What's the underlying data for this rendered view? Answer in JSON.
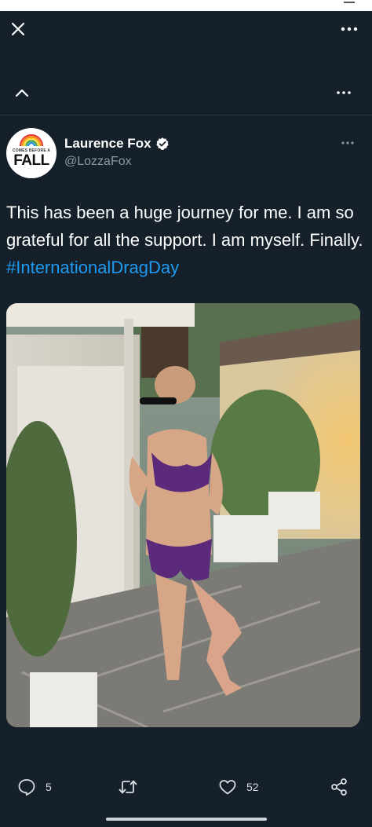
{
  "colors": {
    "background": "#15202b",
    "link": "#1d9bf0",
    "secondary_text": "#8b98a5",
    "verified": "#ffffff"
  },
  "icons": {
    "close": "close-icon",
    "more": "more-horizontal-icon",
    "collapse": "chevron-up-icon",
    "verified": "verified-badge-icon",
    "reply": "reply-icon",
    "retweet": "retweet-icon",
    "like": "heart-icon",
    "share": "share-icon"
  },
  "tweet": {
    "avatar": {
      "small_text": "COMES BEFORE A",
      "big_text": "FALL"
    },
    "author_name": "Laurence Fox",
    "author_handle": "@LozzaFox",
    "text": "This has been a huge journey for me. I am so grateful for all the support. I am myself. Finally. ",
    "hashtag": "#InternationalDragDay"
  },
  "actions": {
    "reply_count": "5",
    "like_count": "52"
  }
}
